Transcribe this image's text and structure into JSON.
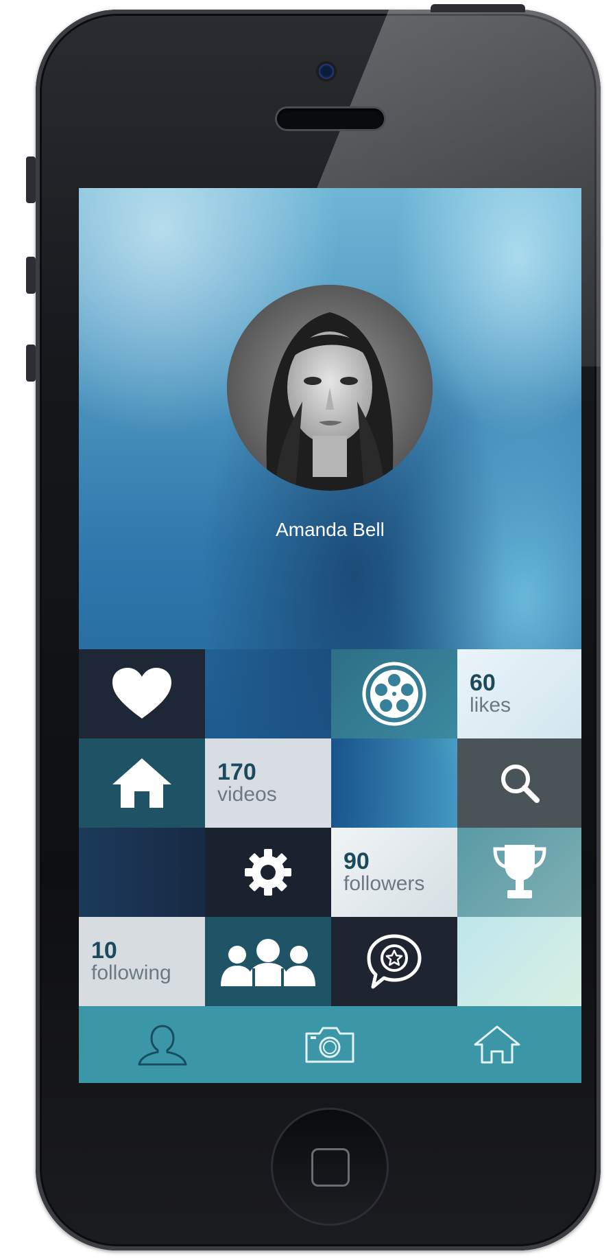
{
  "profile": {
    "name": "Amanda Bell"
  },
  "stats": {
    "likes": {
      "value": "60",
      "label": "likes"
    },
    "videos": {
      "value": "170",
      "label": "videos"
    },
    "followers": {
      "value": "90",
      "label": "followers"
    },
    "following": {
      "value": "10",
      "label": "following"
    }
  },
  "tiles": [
    "heart-icon",
    "film-reel-icon",
    "home-icon",
    "search-icon",
    "settings-gear-icon",
    "trophy-icon",
    "group-icon",
    "chat-star-icon"
  ],
  "tabbar": {
    "items": [
      "profile-tab",
      "camera-tab",
      "home-tab"
    ]
  },
  "colors": {
    "tabbar": "#3b97a8",
    "dark_tile": "#1f2a38",
    "teal_tile": "#215a6c",
    "light_tile": "#d7dde3",
    "number": "#1b4a5c"
  }
}
